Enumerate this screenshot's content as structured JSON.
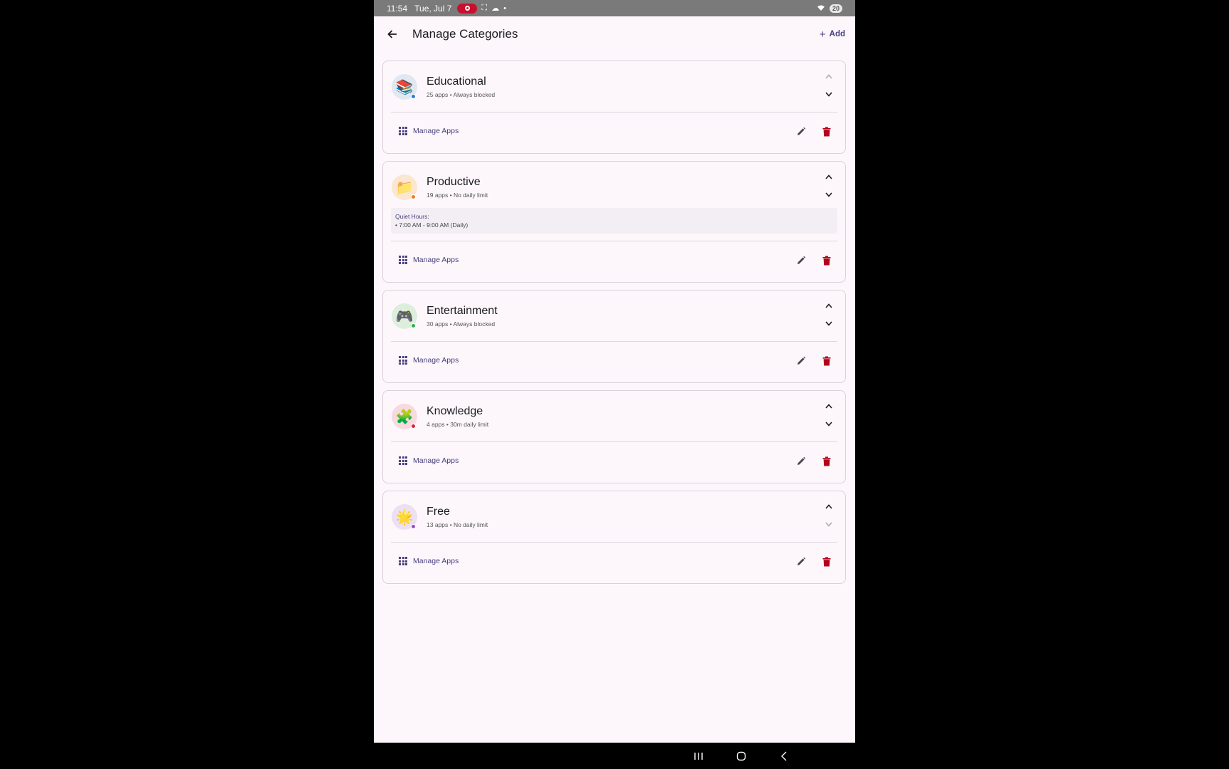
{
  "status": {
    "time": "11:54",
    "date": "Tue, Jul 7",
    "battery": "20"
  },
  "appbar": {
    "title": "Manage Categories",
    "add_label": "Add"
  },
  "colors": {
    "accent": "#4a4080",
    "delete": "#b3001b",
    "background": "#fdf7fb"
  },
  "categories": [
    {
      "name": "Educational",
      "subtitle": "25 apps • Always blocked",
      "icon": "books-icon",
      "icon_glyph": "📚",
      "avatar_bg": "#dfe8f3",
      "dot_color": "#2c7bd8",
      "manage_label": "Manage Apps"
    },
    {
      "name": "Productive",
      "subtitle": "19 apps • No daily limit",
      "icon": "folder-icon",
      "icon_glyph": "📁",
      "avatar_bg": "#fbe6cf",
      "dot_color": "#f07e1a",
      "quiet_label": "Quiet Hours:",
      "quiet_line": "• 7:00 AM - 9:00 AM (Daily)",
      "manage_label": "Manage Apps"
    },
    {
      "name": "Entertainment",
      "subtitle": "30 apps • Always blocked",
      "icon": "game-controller-icon",
      "icon_glyph": "🎮",
      "avatar_bg": "#ddeedd",
      "dot_color": "#2bb24c",
      "manage_label": "Manage Apps"
    },
    {
      "name": "Knowledge",
      "subtitle": "4 apps • 30m daily limit",
      "icon": "puzzle-icon",
      "icon_glyph": "🧩",
      "avatar_bg": "#f7dadd",
      "dot_color": "#d8213a",
      "manage_label": "Manage Apps"
    },
    {
      "name": "Free",
      "subtitle": "13 apps • No daily limit",
      "icon": "star-icon",
      "icon_glyph": "🌟",
      "avatar_bg": "#ece0f2",
      "dot_color": "#9a4fc2",
      "manage_label": "Manage Apps"
    }
  ]
}
